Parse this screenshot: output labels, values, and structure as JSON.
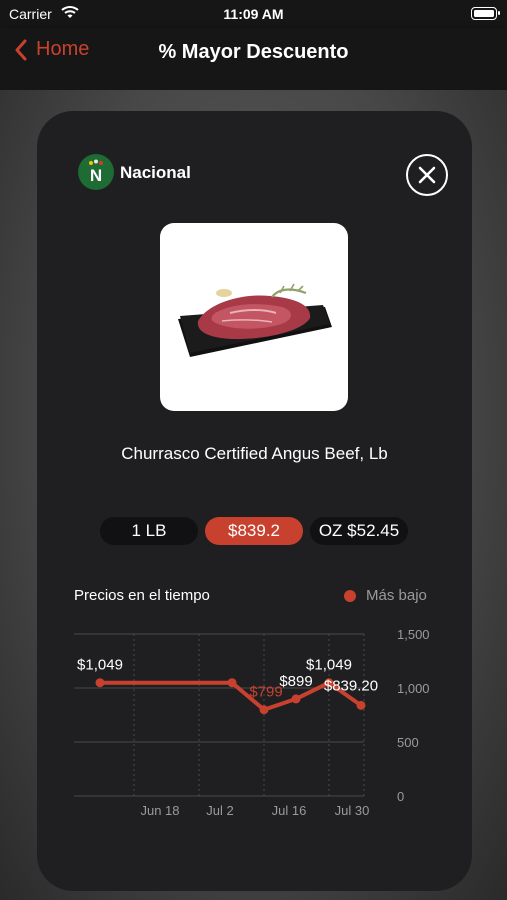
{
  "status_bar": {
    "carrier": "Carrier",
    "time": "11:09 AM"
  },
  "nav": {
    "back_label": "Home",
    "title": "% Mayor Descuento"
  },
  "store": {
    "name": "Nacional",
    "logo_letter": "N"
  },
  "product": {
    "name": "Churrasco Certified Angus Beef, Lb"
  },
  "unit_selector": {
    "unit": "1 LB",
    "price": "$839.2",
    "ounce_price": "OZ $52.45"
  },
  "chart_section": {
    "title": "Precios en el tiempo",
    "legend_label": "Más bajo"
  },
  "colors": {
    "accent": "#c8412e",
    "card": "#1f1f21",
    "nav": "#161616"
  },
  "chart_data": {
    "type": "line",
    "x": [
      "Jun 4",
      "Jul 4",
      "Jul 11",
      "Jul 18",
      "Jul 25",
      "Aug 1"
    ],
    "y": [
      1049,
      1049,
      799,
      899,
      1049,
      839.2
    ],
    "point_labels": [
      "$1,049",
      "",
      "$799",
      "$899",
      "$1,049",
      "$839.20"
    ],
    "x_tick_labels": [
      "Jun 18",
      "Jul 2",
      "Jul 16",
      "Jul 30"
    ],
    "y_ticks": [
      0,
      500,
      1000,
      1500
    ],
    "y_tick_labels": [
      "0",
      "500",
      "1,000",
      "1,500"
    ],
    "ylim": [
      0,
      1500
    ],
    "grid": true,
    "series_color": "#c8412e"
  }
}
